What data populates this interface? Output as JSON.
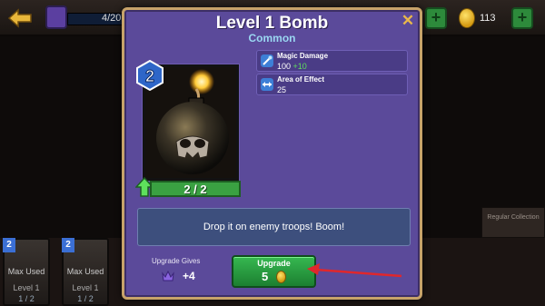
{
  "hud": {
    "progress_text": "4/20",
    "coins": "113"
  },
  "modal": {
    "title": "Level 1 Bomb",
    "rarity": "Common",
    "card_level": "2",
    "card_progress": "2 / 2",
    "card_progress_fraction": 1.0,
    "stats": [
      {
        "name": "Magic Damage",
        "value": "100",
        "bonus": "+10",
        "icon": "wand-icon"
      },
      {
        "name": "Area of Effect",
        "value": "25",
        "bonus": "",
        "icon": "area-icon"
      }
    ],
    "description": "Drop it on enemy troops! Boom!",
    "upgrade_gives_label": "Upgrade Gives",
    "upgrade_gives_amount": "+4",
    "upgrade_button_label": "Upgrade",
    "upgrade_cost": "5"
  },
  "background_cards": [
    {
      "level": "2",
      "status": "Max Used",
      "level_text": "Level 1",
      "count": "1 / 2"
    },
    {
      "level": "2",
      "status": "Max Used",
      "level_text": "Level 1",
      "count": "1 / 2"
    }
  ],
  "side_panel": {
    "label": "Regular Collection"
  },
  "colors": {
    "modal_bg": "#5b4a9a",
    "modal_border": "#c7a36a",
    "rarity_text": "#9ad7f2",
    "button_green": "#36b850",
    "bonus_green": "#5ee05c",
    "annotation_red": "#e0272c"
  }
}
